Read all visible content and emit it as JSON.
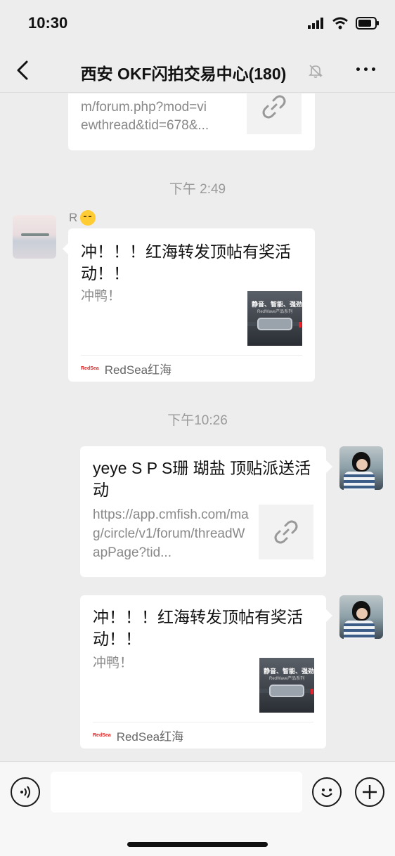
{
  "status_bar": {
    "time": "10:30"
  },
  "header": {
    "title": "西安 OKF闪拍交易中心(180)"
  },
  "messages": [
    {
      "type": "link",
      "side": "left",
      "partial": true,
      "title": "",
      "desc_lines": [
        "m/forum.php?mod=vi",
        "ewthread&tid=678&..."
      ],
      "icon": "link-icon"
    },
    {
      "type": "time",
      "text": "下午 2:49"
    },
    {
      "type": "article",
      "side": "left",
      "sender": "R",
      "title": "冲！！！红海转发顶帖有奖活动！！",
      "desc": "冲鸭！",
      "thumb_title": "静音、智能、强劲",
      "thumb_sub": "RedWave产品系列",
      "source": "RedSea红海"
    },
    {
      "type": "time",
      "text": "下午10:26"
    },
    {
      "type": "link",
      "side": "right",
      "title": "yeye S P S珊 瑚盐 顶贴派送活动",
      "desc": "https://app.cmfish.com/mag/circle/v1/forum/threadWapPage?tid...",
      "icon": "link-icon"
    },
    {
      "type": "article",
      "side": "right",
      "title": "冲！！！红海转发顶帖有奖活动！！",
      "desc": "冲鸭！",
      "thumb_title": "静音、智能、强劲",
      "thumb_sub": "RedWave产品系列",
      "source": "RedSea红海"
    }
  ],
  "input_bar": {
    "placeholder": ""
  }
}
